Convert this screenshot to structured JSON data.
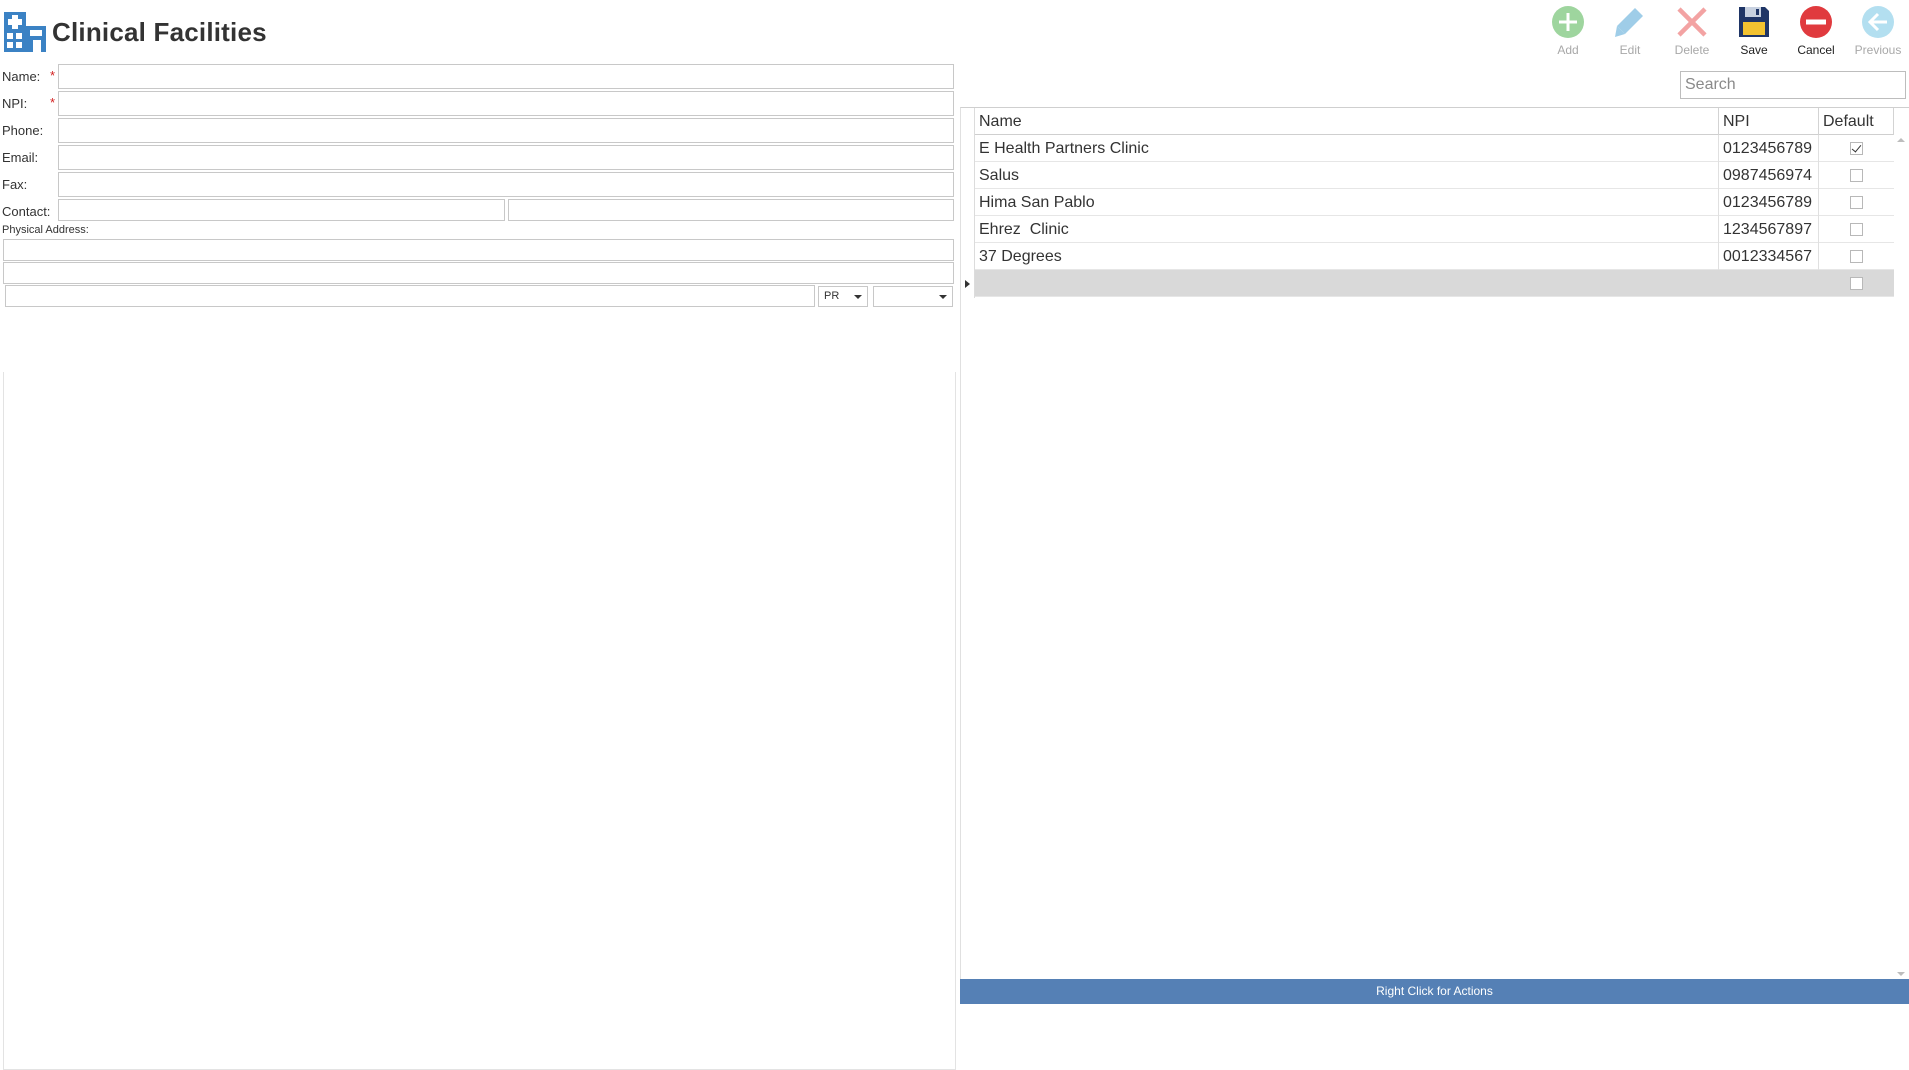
{
  "header": {
    "title": "Clinical Facilities",
    "icon": "hospital-icon"
  },
  "toolbar": {
    "add": {
      "label": "Add",
      "enabled": false,
      "icon": "plus-circle-icon",
      "color": "#9ed59e"
    },
    "edit": {
      "label": "Edit",
      "enabled": false,
      "icon": "pencil-icon",
      "color": "#9fcde8"
    },
    "delete": {
      "label": "Delete",
      "enabled": false,
      "icon": "x-icon",
      "color": "#f3a3a3"
    },
    "save": {
      "label": "Save",
      "enabled": true,
      "icon": "floppy-disk-icon",
      "color": "#1f3566"
    },
    "cancel": {
      "label": "Cancel",
      "enabled": true,
      "icon": "no-entry-icon",
      "color": "#e03a3e"
    },
    "previous": {
      "label": "Previous",
      "enabled": false,
      "icon": "arrow-left-circle-icon",
      "color": "#b3dff0"
    }
  },
  "form": {
    "name_label": "Name:",
    "npi_label": "NPI:",
    "phone_label": "Phone:",
    "email_label": "Email:",
    "fax_label": "Fax:",
    "contact_label": "Contact:",
    "physical_address_label": "Physical Address:",
    "required_marker": "*",
    "name_value": "",
    "npi_value": "",
    "phone_value": "",
    "email_value": "",
    "fax_value": "",
    "contact_first_value": "",
    "contact_second_value": "",
    "address_line1_value": "",
    "address_line2_value": "",
    "city_value": "",
    "state_selected": "PR",
    "zip_selected": ""
  },
  "search": {
    "placeholder": "Search",
    "value": ""
  },
  "grid": {
    "columns": {
      "name": "Name",
      "npi": "NPI",
      "default": "Default"
    },
    "rows": [
      {
        "name": "E Health Partners Clinic",
        "npi": "0123456789",
        "default": true
      },
      {
        "name": "Salus",
        "npi": "0987456974",
        "default": false
      },
      {
        "name": "Hima San Pablo",
        "npi": "0123456789",
        "default": false
      },
      {
        "name": "Ehrez  Clinic",
        "npi": "1234567897",
        "default": false
      },
      {
        "name": "37 Degrees",
        "npi": "0012334567",
        "default": false
      }
    ]
  },
  "status_bar": {
    "text": "Right Click for Actions",
    "color": "#5580b5"
  }
}
